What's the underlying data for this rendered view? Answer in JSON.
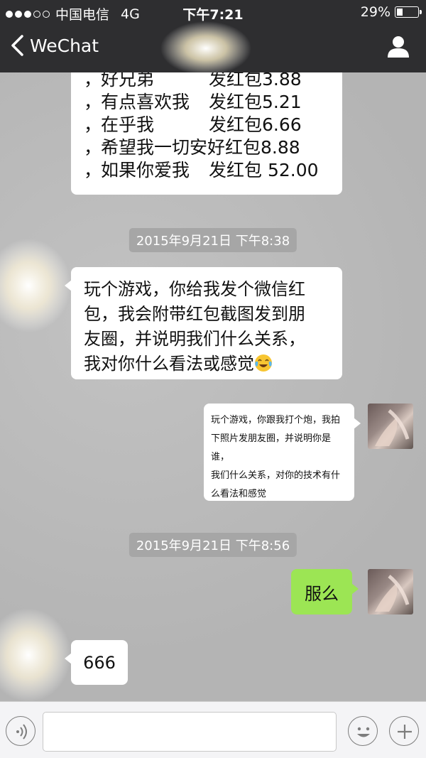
{
  "status_bar": {
    "signal_dots": [
      true,
      true,
      true,
      false,
      false
    ],
    "carrier": "中国电信",
    "network": "4G",
    "time": "下午7:21",
    "battery_text": "29%",
    "battery_level": 0.29
  },
  "nav": {
    "back_label": "WeChat",
    "right_icon": "person-icon"
  },
  "messages": {
    "list_bubble": {
      "rows": [
        {
          "prefix": "，",
          "name": "好兄弟",
          "action": "发红包3.88"
        },
        {
          "prefix": "，",
          "name": "有点喜欢我",
          "action": "发红包5.21"
        },
        {
          "prefix": "，",
          "name": "在乎我",
          "action": "发红包6.66"
        },
        {
          "prefix": "，",
          "name": "希望我一切安好红包8.88",
          "action": ""
        },
        {
          "prefix": "，",
          "name": "如果你爱我",
          "action": "发红包 52.00"
        }
      ]
    },
    "timestamp_1": "2015年9月21日 下午8:38",
    "incoming_game": {
      "lines": [
        "玩个游戏，你给我发个微信红",
        "包，我会附带红包截图发到朋",
        "友圈，并说明我们什么关系，",
        "我对你什么看法或感觉"
      ],
      "emoji": "tears-of-joy-emoji"
    },
    "outgoing_game": {
      "lines": [
        "玩个游戏，你跟我打个炮，我拍",
        "下照片发朋友圈，并说明你是谁，",
        "我们什么关系，对你的技术有什",
        "么看法和感觉"
      ]
    },
    "timestamp_2": "2015年9月21日 下午8:56",
    "outgoing_short": "服么",
    "incoming_short": "666"
  },
  "input_bar": {
    "voice_icon": "voice-icon",
    "emoji_icon": "smiley-icon",
    "plus_icon": "plus-icon",
    "text_value": ""
  },
  "colors": {
    "header_bg": "#2e2e30",
    "chat_bg": "#b8b8b8",
    "sent_bubble": "#9ce554",
    "received_bubble": "#ffffff",
    "timestamp_bg": "#a6a6a6"
  }
}
